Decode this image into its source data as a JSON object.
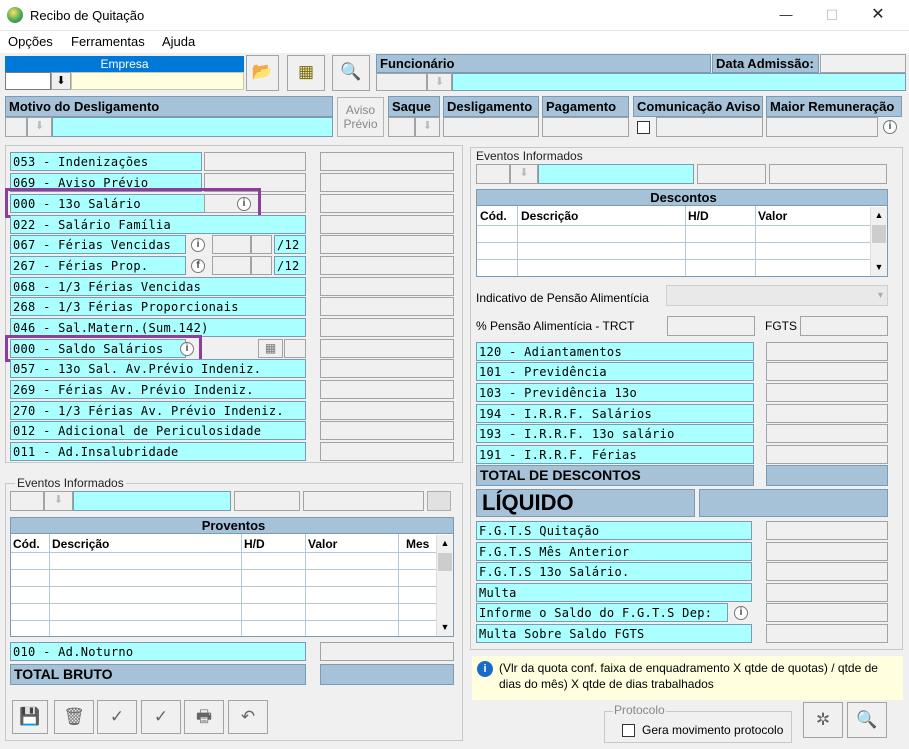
{
  "window": {
    "title": "Recibo de Quitação",
    "minimize": "—",
    "maximize": "☐",
    "close": "✕"
  },
  "menu": [
    {
      "label": "Opções"
    },
    {
      "label": "Ferramentas"
    },
    {
      "label": "Ajuda"
    }
  ],
  "top": {
    "empresa_label": "Empresa",
    "funcionario_label": "Funcionário",
    "data_admissao_label": "Data Admissão:"
  },
  "motivo": {
    "motivo_label": "Motivo do Desligamento",
    "aviso_previo_l1": "Aviso",
    "aviso_previo_l2": "Prévio",
    "saque_label": "Saque",
    "desligamento_label": "Desligamento",
    "pagamento_label": "Pagamento",
    "comunicacao_label": "Comunicação Aviso",
    "maior_remuneracao_label": "Maior Remuneração"
  },
  "proventos_left": [
    {
      "label": "053 - Indenizações"
    },
    {
      "label": "069 - Aviso Prévio"
    },
    {
      "label": "000 - 13o Salário"
    },
    {
      "label": "022 - Salário Família"
    },
    {
      "label": "067 - Férias Vencidas",
      "suffix": "/12"
    },
    {
      "label": "267 - Férias Prop.",
      "suffix": "/12"
    },
    {
      "label": "068 - 1/3 Férias Vencidas"
    },
    {
      "label": "268 - 1/3 Férias Proporcionais"
    },
    {
      "label": "046 - Sal.Matern.(Sum.142)"
    },
    {
      "label": "000 - Saldo Salários"
    },
    {
      "label": "057 - 13o Sal. Av.Prévio Indeniz."
    },
    {
      "label": "269 - Férias  Av. Prévio Indeniz."
    },
    {
      "label": "270 - 1/3 Férias Av. Prévio Indeniz."
    },
    {
      "label": "012 - Adicional de Periculosidade"
    },
    {
      "label": "011 - Ad.Insalubridade"
    }
  ],
  "eventos_left": {
    "legend": "Eventos Informados",
    "grid_title": "Proventos",
    "columns": [
      "Cód.",
      "Descrição",
      "H/D",
      "Valor",
      "Mes"
    ],
    "ad_noturno": "010 - Ad.Noturno",
    "total_bruto": "TOTAL BRUTO"
  },
  "eventos_right": {
    "legend": "Eventos Informados",
    "grid_title": "Descontos",
    "columns": [
      "Cód.",
      "Descrição",
      "H/D",
      "Valor"
    ]
  },
  "pensao": {
    "indicativo_label": "Indicativo de Pensão Alimentícia",
    "percent_label": "% Pensão Alimentícia - TRCT",
    "fgts_label": "FGTS"
  },
  "descontos_right": [
    {
      "label": "120 - Adiantamentos"
    },
    {
      "label": "101 - Previdência"
    },
    {
      "label": "103 - Previdência 13o"
    },
    {
      "label": "194 - I.R.R.F. Salários"
    },
    {
      "label": "193 - I.R.R.F. 13o salário"
    },
    {
      "label": "191 - I.R.R.F. Férias"
    }
  ],
  "total_descontos": "TOTAL DE DESCONTOS",
  "liquido": "LÍQUIDO",
  "fgts_rows": [
    {
      "label": "F.G.T.S  Quitação"
    },
    {
      "label": "F.G.T.S  Mês Anterior"
    },
    {
      "label": "F.G.T.S  13o Salário."
    },
    {
      "label": "Multa"
    },
    {
      "label": "Informe o Saldo do F.G.T.S Dep:"
    },
    {
      "label": "Multa Sobre Saldo FGTS"
    }
  ],
  "note": "(Vlr da quota conf. faixa de enquadramento X qtde de quotas) / qtde de dias do mês) X qtde de dias trabalhados",
  "protocolo": {
    "legend": "Protocolo",
    "checkbox_label": "Gera movimento protocolo"
  },
  "colors": {
    "cyan": "#aaffff",
    "header_blue": "#a6c2d9",
    "highlight": "#8e3d9a",
    "empresa_blue": "#0078d7"
  }
}
